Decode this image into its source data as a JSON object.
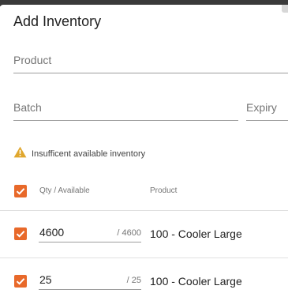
{
  "dialog": {
    "title": "Add Inventory",
    "product_placeholder": "Product",
    "batch_placeholder": "Batch",
    "expiry_placeholder": "Expiry",
    "warning_text": "Insufficent available inventory"
  },
  "table": {
    "columns": [
      "Qty / Available",
      "Product"
    ],
    "header_checked": true,
    "rows": [
      {
        "checked": true,
        "qty": "4600",
        "available": "/ 4600",
        "product": "100 - Cooler Large"
      },
      {
        "checked": true,
        "qty": "25",
        "available": "/ 25",
        "product": "100 - Cooler Large"
      }
    ]
  },
  "colors": {
    "accent": "#e8692a",
    "warning": "#e0a72e"
  },
  "icons": {
    "warning": "warning-triangle-icon",
    "checkbox": "checkbox-checked-icon"
  }
}
